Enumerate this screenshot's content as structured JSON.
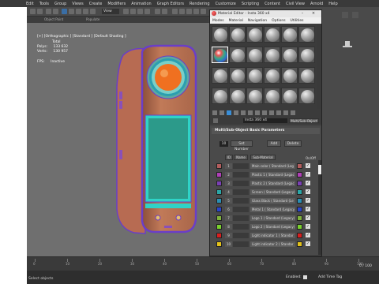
{
  "menubar": [
    "Edit",
    "Tools",
    "Group",
    "Views",
    "Create",
    "Modifiers",
    "Animation",
    "Graph Editors",
    "Rendering",
    "Customize",
    "Scripting",
    "Content",
    "Civil View",
    "Arnold",
    "Help"
  ],
  "toolbar": {
    "view_dropdown": "View"
  },
  "command_bar": {
    "left": "Object Paint",
    "right": "Populate"
  },
  "viewport": {
    "label": "[+] [Orthographic ] [Standard ] [Default Shading ]",
    "stats_header": "Total",
    "polys_label": "Polys:",
    "polys_value": "133 632",
    "verts_label": "Verts:",
    "verts_value": "130 957",
    "fps_label": "FPS:",
    "fps_value": "Inactive"
  },
  "material_editor": {
    "title": "Material Editor - Insta 360 x4",
    "menu": [
      "Modes",
      "Material",
      "Navigation",
      "Options",
      "Utilities"
    ],
    "material_name": "Insta 360 x4",
    "material_type": "Multi/Sub-Object",
    "rollout_title": "Multi/Sub-Object Basic Parameters",
    "count": "10",
    "set_number_label": "Set Number",
    "add_label": "Add",
    "delete_label": "Delete",
    "col_id": "ID",
    "col_name": "Name",
    "col_submaterial": "Sub-Material",
    "col_onoff": "On/Off",
    "rows": [
      {
        "id": "1",
        "material": "Main color ( Standard (Leg",
        "color": "#b35d5d"
      },
      {
        "id": "2",
        "material": "Plastic 1 ( Standard (Legac",
        "color": "#b03fb8"
      },
      {
        "id": "3",
        "material": "Plastic 2 ( Standard (Legac",
        "color": "#7a3fb5"
      },
      {
        "id": "4",
        "material": "Screen ( Standard (Legacy)",
        "color": "#2aa7a7"
      },
      {
        "id": "5",
        "material": "Glass Black ( Standard (Le",
        "color": "#2b8fb3"
      },
      {
        "id": "6",
        "material": "Metal 1 ( Standard (Legacy",
        "color": "#2a44c9"
      },
      {
        "id": "7",
        "material": "Logo 1 ( Standard (Legacy)",
        "color": "#7fb13c"
      },
      {
        "id": "8",
        "material": "Logo 2 ( Standard (Legacy)",
        "color": "#79d12c"
      },
      {
        "id": "9",
        "material": "Light indicator 1 ( Standar",
        "color": "#d91e1e"
      },
      {
        "id": "10",
        "material": "Light indicator 2 ( Standar",
        "color": "#e3c21a"
      }
    ]
  },
  "timeline": {
    "ticks": [
      "0",
      "10",
      "20",
      "30",
      "40",
      "50",
      "60",
      "70",
      "80",
      "90",
      "100"
    ],
    "frame": "0 / 100"
  },
  "status": {
    "left": "Select objects",
    "enabled_label": "Enabled:",
    "add_time_tag": "Add Time Tag"
  },
  "colors": {
    "accent": "#1e90ff",
    "body": "#c87c5a",
    "screen": "#2fd3c7",
    "trim": "#6a3ec8"
  }
}
